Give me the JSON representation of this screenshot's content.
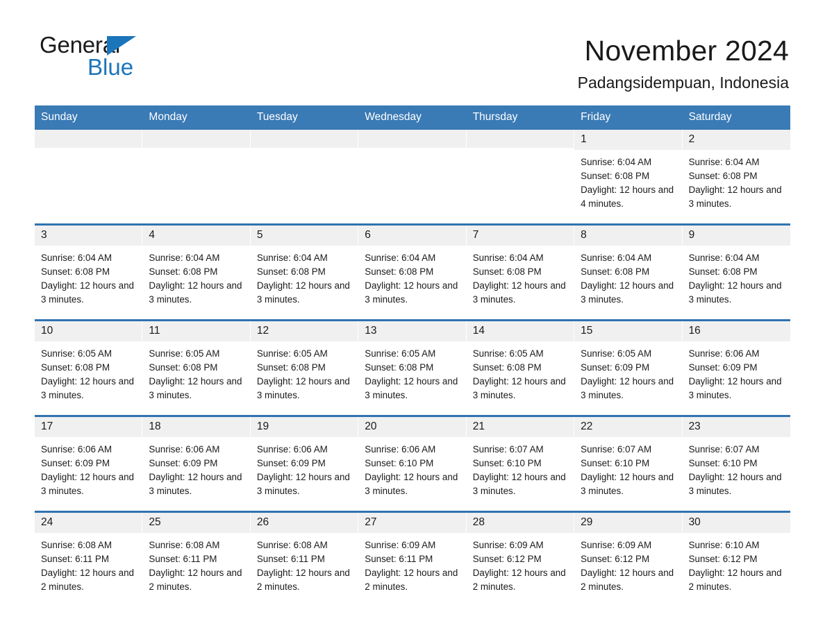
{
  "brand": {
    "name_part1": "General",
    "name_part2": "Blue",
    "triangle_color": "#1b75bb"
  },
  "header": {
    "title": "November 2024",
    "subtitle": "Padangsidempuan, Indonesia"
  },
  "colors": {
    "header_bar": "#3a7ab5",
    "week_separator": "#2f72b0",
    "day_number_band": "#f0f0f0",
    "text": "#1a1a1a"
  },
  "weekdays": [
    "Sunday",
    "Monday",
    "Tuesday",
    "Wednesday",
    "Thursday",
    "Friday",
    "Saturday"
  ],
  "labels": {
    "sunrise": "Sunrise:",
    "sunset": "Sunset:",
    "daylight": "Daylight:"
  },
  "weeks": [
    [
      {
        "day": "",
        "empty": true
      },
      {
        "day": "",
        "empty": true
      },
      {
        "day": "",
        "empty": true
      },
      {
        "day": "",
        "empty": true
      },
      {
        "day": "",
        "empty": true
      },
      {
        "day": "1",
        "sunrise": "Sunrise: 6:04 AM",
        "sunset": "Sunset: 6:08 PM",
        "daylight": "Daylight: 12 hours and 4 minutes."
      },
      {
        "day": "2",
        "sunrise": "Sunrise: 6:04 AM",
        "sunset": "Sunset: 6:08 PM",
        "daylight": "Daylight: 12 hours and 3 minutes."
      }
    ],
    [
      {
        "day": "3",
        "sunrise": "Sunrise: 6:04 AM",
        "sunset": "Sunset: 6:08 PM",
        "daylight": "Daylight: 12 hours and 3 minutes."
      },
      {
        "day": "4",
        "sunrise": "Sunrise: 6:04 AM",
        "sunset": "Sunset: 6:08 PM",
        "daylight": "Daylight: 12 hours and 3 minutes."
      },
      {
        "day": "5",
        "sunrise": "Sunrise: 6:04 AM",
        "sunset": "Sunset: 6:08 PM",
        "daylight": "Daylight: 12 hours and 3 minutes."
      },
      {
        "day": "6",
        "sunrise": "Sunrise: 6:04 AM",
        "sunset": "Sunset: 6:08 PM",
        "daylight": "Daylight: 12 hours and 3 minutes."
      },
      {
        "day": "7",
        "sunrise": "Sunrise: 6:04 AM",
        "sunset": "Sunset: 6:08 PM",
        "daylight": "Daylight: 12 hours and 3 minutes."
      },
      {
        "day": "8",
        "sunrise": "Sunrise: 6:04 AM",
        "sunset": "Sunset: 6:08 PM",
        "daylight": "Daylight: 12 hours and 3 minutes."
      },
      {
        "day": "9",
        "sunrise": "Sunrise: 6:04 AM",
        "sunset": "Sunset: 6:08 PM",
        "daylight": "Daylight: 12 hours and 3 minutes."
      }
    ],
    [
      {
        "day": "10",
        "sunrise": "Sunrise: 6:05 AM",
        "sunset": "Sunset: 6:08 PM",
        "daylight": "Daylight: 12 hours and 3 minutes."
      },
      {
        "day": "11",
        "sunrise": "Sunrise: 6:05 AM",
        "sunset": "Sunset: 6:08 PM",
        "daylight": "Daylight: 12 hours and 3 minutes."
      },
      {
        "day": "12",
        "sunrise": "Sunrise: 6:05 AM",
        "sunset": "Sunset: 6:08 PM",
        "daylight": "Daylight: 12 hours and 3 minutes."
      },
      {
        "day": "13",
        "sunrise": "Sunrise: 6:05 AM",
        "sunset": "Sunset: 6:08 PM",
        "daylight": "Daylight: 12 hours and 3 minutes."
      },
      {
        "day": "14",
        "sunrise": "Sunrise: 6:05 AM",
        "sunset": "Sunset: 6:08 PM",
        "daylight": "Daylight: 12 hours and 3 minutes."
      },
      {
        "day": "15",
        "sunrise": "Sunrise: 6:05 AM",
        "sunset": "Sunset: 6:09 PM",
        "daylight": "Daylight: 12 hours and 3 minutes."
      },
      {
        "day": "16",
        "sunrise": "Sunrise: 6:06 AM",
        "sunset": "Sunset: 6:09 PM",
        "daylight": "Daylight: 12 hours and 3 minutes."
      }
    ],
    [
      {
        "day": "17",
        "sunrise": "Sunrise: 6:06 AM",
        "sunset": "Sunset: 6:09 PM",
        "daylight": "Daylight: 12 hours and 3 minutes."
      },
      {
        "day": "18",
        "sunrise": "Sunrise: 6:06 AM",
        "sunset": "Sunset: 6:09 PM",
        "daylight": "Daylight: 12 hours and 3 minutes."
      },
      {
        "day": "19",
        "sunrise": "Sunrise: 6:06 AM",
        "sunset": "Sunset: 6:09 PM",
        "daylight": "Daylight: 12 hours and 3 minutes."
      },
      {
        "day": "20",
        "sunrise": "Sunrise: 6:06 AM",
        "sunset": "Sunset: 6:10 PM",
        "daylight": "Daylight: 12 hours and 3 minutes."
      },
      {
        "day": "21",
        "sunrise": "Sunrise: 6:07 AM",
        "sunset": "Sunset: 6:10 PM",
        "daylight": "Daylight: 12 hours and 3 minutes."
      },
      {
        "day": "22",
        "sunrise": "Sunrise: 6:07 AM",
        "sunset": "Sunset: 6:10 PM",
        "daylight": "Daylight: 12 hours and 3 minutes."
      },
      {
        "day": "23",
        "sunrise": "Sunrise: 6:07 AM",
        "sunset": "Sunset: 6:10 PM",
        "daylight": "Daylight: 12 hours and 3 minutes."
      }
    ],
    [
      {
        "day": "24",
        "sunrise": "Sunrise: 6:08 AM",
        "sunset": "Sunset: 6:11 PM",
        "daylight": "Daylight: 12 hours and 2 minutes."
      },
      {
        "day": "25",
        "sunrise": "Sunrise: 6:08 AM",
        "sunset": "Sunset: 6:11 PM",
        "daylight": "Daylight: 12 hours and 2 minutes."
      },
      {
        "day": "26",
        "sunrise": "Sunrise: 6:08 AM",
        "sunset": "Sunset: 6:11 PM",
        "daylight": "Daylight: 12 hours and 2 minutes."
      },
      {
        "day": "27",
        "sunrise": "Sunrise: 6:09 AM",
        "sunset": "Sunset: 6:11 PM",
        "daylight": "Daylight: 12 hours and 2 minutes."
      },
      {
        "day": "28",
        "sunrise": "Sunrise: 6:09 AM",
        "sunset": "Sunset: 6:12 PM",
        "daylight": "Daylight: 12 hours and 2 minutes."
      },
      {
        "day": "29",
        "sunrise": "Sunrise: 6:09 AM",
        "sunset": "Sunset: 6:12 PM",
        "daylight": "Daylight: 12 hours and 2 minutes."
      },
      {
        "day": "30",
        "sunrise": "Sunrise: 6:10 AM",
        "sunset": "Sunset: 6:12 PM",
        "daylight": "Daylight: 12 hours and 2 minutes."
      }
    ]
  ]
}
